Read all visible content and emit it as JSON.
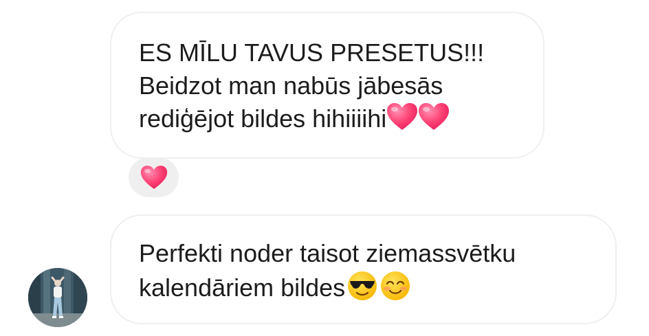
{
  "messages": [
    {
      "lines": [
        "ES MĪLU TAVUS PRESETUS!!!",
        "Beidzot man nabūs jābesās",
        "rediģējot bildes hihiiiihi"
      ],
      "trailing_emoji": [
        "heart-emoji",
        "heart-emoji"
      ],
      "reaction": "heart-emoji"
    },
    {
      "lines": [
        "Perfekti noder taisot ziemassvētku",
        "kalendāriem bildes"
      ],
      "trailing_emoji": [
        "smiling-face-with-sunglasses-emoji",
        "smiling-face-with-smiling-eyes-emoji"
      ]
    }
  ],
  "colors": {
    "bubble_border": "#efefef",
    "reaction_bg": "#efefef",
    "text": "#1c1c1c",
    "heart": "#ff3f73"
  }
}
